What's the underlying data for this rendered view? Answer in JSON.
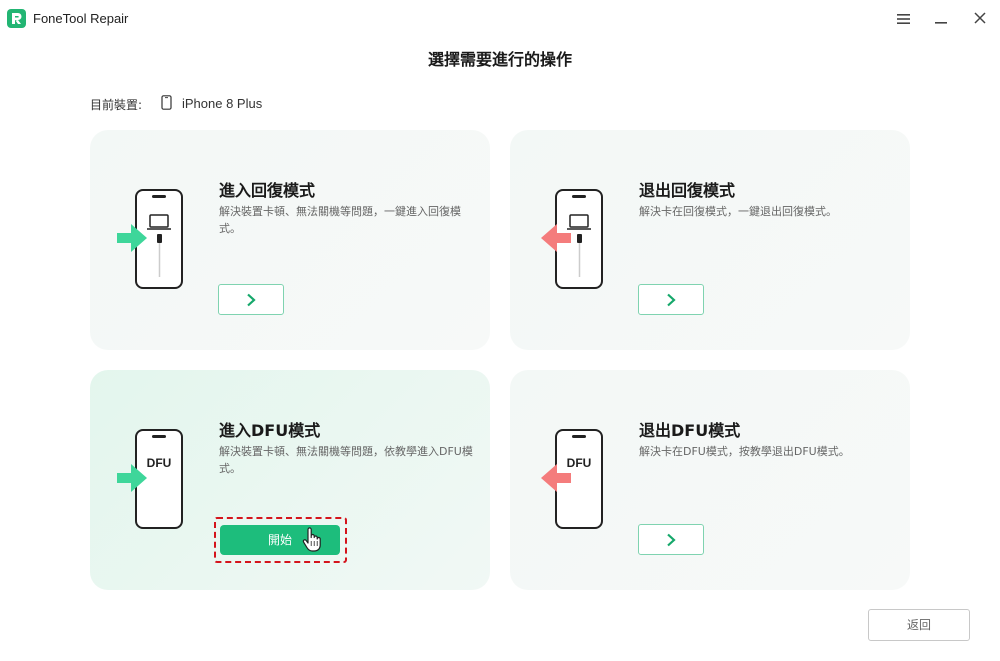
{
  "app": {
    "name": "FoneTool Repair"
  },
  "page": {
    "title": "選擇需要進行的操作"
  },
  "device": {
    "label": "目前裝置:",
    "name": "iPhone 8 Plus"
  },
  "cards": [
    {
      "title": "進入回復模式",
      "description": "解決裝置卡頓、無法關機等問題，一鍵進入回復模式。"
    },
    {
      "title": "退出回復模式",
      "description": "解決卡在回復模式，一鍵退出回復模式。"
    },
    {
      "title": "進入DFU模式",
      "description": "解決裝置卡頓、無法關機等問題，依教學進入DFU模式。",
      "button_label": "開始",
      "screen_text": "DFU"
    },
    {
      "title": "退出DFU模式",
      "description": "解決卡在DFU模式，按教學退出DFU模式。",
      "screen_text": "DFU"
    }
  ],
  "footer": {
    "back_label": "返回"
  },
  "colors": {
    "accent": "#1dbd7c",
    "enter_arrow": "#3ed69a",
    "exit_arrow": "#f47c7c",
    "highlight": "#d4141c"
  }
}
